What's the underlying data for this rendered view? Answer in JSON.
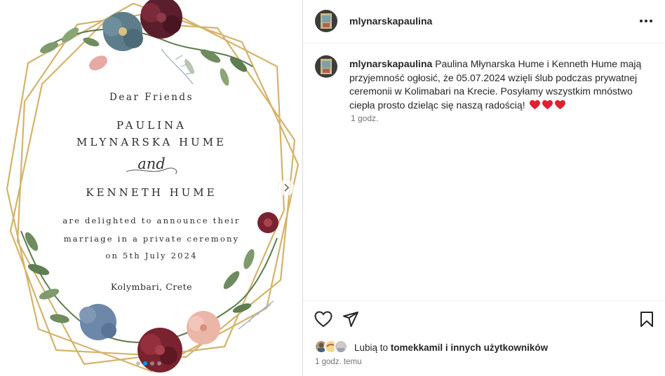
{
  "card": {
    "greeting": "Dear Friends",
    "name_line1": "PAULINA",
    "name_line2": "MLYNARSKA HUME",
    "and": "and",
    "name_line3": "KENNETH HUME",
    "announce_line1": "are delighted to announce their",
    "announce_line2": "marriage in a private ceremony",
    "announce_line3": "on 5th July 2024",
    "location": "Kolymbari, Crete"
  },
  "post": {
    "username": "mlynarskapaulina",
    "caption_text": "Paulina Młynarska Hume i Kenneth Hume mają przyjemność ogłosić, że 05.07.2024 wzięli ślub podczas prywatnej ceremonii w Kolimabari na Krecie. Posyłamy wszystkim mnóstwo ciepła prosto dzieląc się naszą radością!",
    "caption_time": "1 godz.",
    "likes_prefix": "Lubią to",
    "likes_user": "tomekkamil",
    "likes_suffix": "i innych użytkowników",
    "post_time": "1 godz. temu"
  },
  "icons": {
    "more": "more-horizontal-icon",
    "like": "heart-outline-icon",
    "share": "send-paper-plane-icon",
    "save": "bookmark-outline-icon",
    "next": "chevron-right-icon",
    "heart_emoji": "red-heart-icon"
  },
  "colors": {
    "gold": "#d4b36a",
    "accent_blue": "#0095f6",
    "heart_red": "#e0202e",
    "muted_text": "#737373"
  },
  "carousel": {
    "current_index": 1,
    "total": 4
  }
}
